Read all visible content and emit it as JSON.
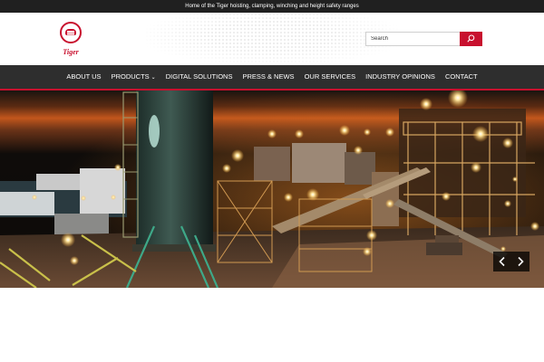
{
  "topbar": {
    "text": "Home of the Tiger hoisting, clamping, winching and height safety ranges"
  },
  "logo": {
    "text": "Tiger"
  },
  "search": {
    "placeholder": "Search",
    "button_icon": "search-icon"
  },
  "nav": {
    "items": [
      {
        "label": "ABOUT US"
      },
      {
        "label": "PRODUCTS",
        "has_dropdown": true
      },
      {
        "label": "DIGITAL SOLUTIONS"
      },
      {
        "label": "PRESS & NEWS"
      },
      {
        "label": "OUR SERVICES"
      },
      {
        "label": "INDUSTRY OPINIONS"
      },
      {
        "label": "CONTACT"
      }
    ]
  },
  "hero": {
    "image": "industrial plant at night",
    "controls": {
      "prev_icon": "chevron-left-icon",
      "next_icon": "chevron-right-icon"
    }
  },
  "colors": {
    "accent": "#c8102e",
    "nav_bg": "#2e2e2e",
    "topbar_bg": "#202020"
  }
}
